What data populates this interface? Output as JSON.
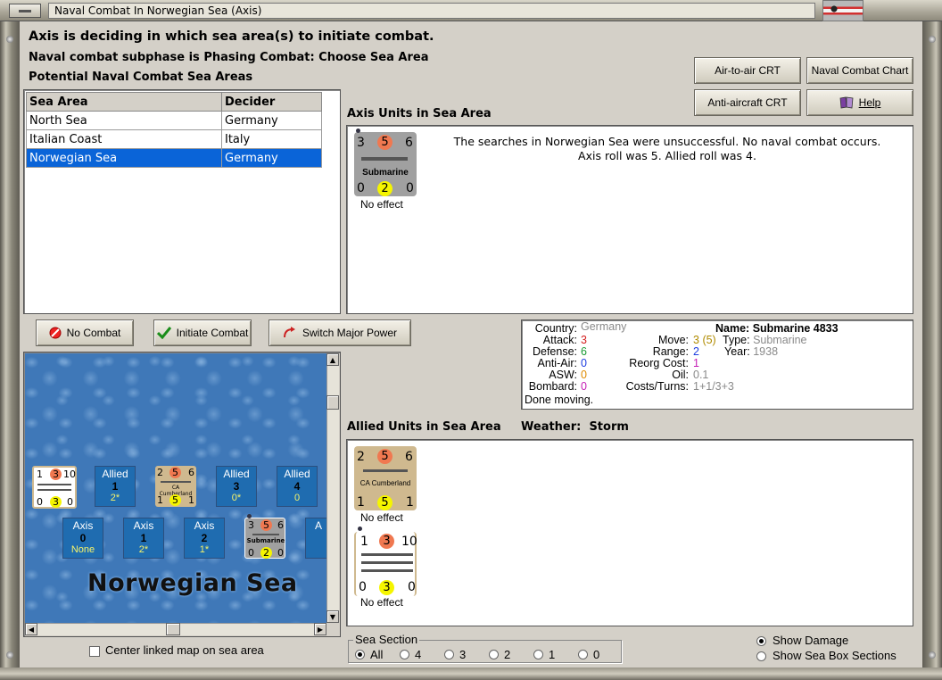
{
  "window": {
    "title": "Naval Combat In Norwegian Sea (Axis)"
  },
  "messages": {
    "headline": "Axis is deciding in which sea area(s) to initiate combat.",
    "subphase": "Naval combat subphase is Phasing Combat: Choose Sea Area",
    "potential_label": "Potential Naval Combat Sea Areas"
  },
  "top_buttons": {
    "air_to_air": "Air-to-air CRT",
    "naval_chart": "Naval Combat Chart",
    "anti_aircraft": "Anti-aircraft CRT",
    "help": "Help"
  },
  "sea_table": {
    "columns": [
      "Sea Area",
      "Decider"
    ],
    "rows": [
      [
        "North Sea",
        "Germany"
      ],
      [
        "Italian Coast",
        "Italy"
      ],
      [
        "Norwegian Sea",
        "Germany"
      ]
    ],
    "selected_row": 2
  },
  "axis_units": {
    "label": "Axis Units in Sea Area",
    "counter": {
      "left": "3",
      "mid": "5",
      "right": "6",
      "type": "Submarine",
      "bl": "0",
      "bm": "2",
      "br": "0"
    },
    "effect": "No effect",
    "result_line1": "The searches in Norwegian Sea were unsuccessful.  No naval combat occurs.",
    "result_line2": "Axis roll was 5.  Allied roll was 4."
  },
  "action_buttons": {
    "no_combat": "No Combat",
    "initiate": "Initiate Combat",
    "switch": "Switch Major Power"
  },
  "unit_info": {
    "country_k": "Country:",
    "country_v": "Germany",
    "attack_k": "Attack:",
    "attack_v": "3",
    "defense_k": "Defense:",
    "defense_v": "6",
    "antiair_k": "Anti-Air:",
    "antiair_v": "0",
    "asw_k": "ASW:",
    "asw_v": "0",
    "bombard_k": "Bombard:",
    "bombard_v": "0",
    "status": "Done moving.",
    "move_k": "Move:",
    "move_v": "3",
    "move_extra": "(5)",
    "range_k": "Range:",
    "range_v": "2",
    "reorg_k": "Reorg Cost:",
    "reorg_v": "1",
    "oil_k": "Oil:",
    "oil_v": "0.1",
    "costs_k": "Costs/Turns:",
    "costs_v": "1+1/3+3",
    "name_k": "Name:",
    "name_v": "Submarine 4833",
    "type_k": "Type:",
    "type_v": "Submarine",
    "year_k": "Year:",
    "year_v": "1938"
  },
  "allied": {
    "label": "Allied Units in Sea Area",
    "weather_label": "Weather:",
    "weather_value": "Storm",
    "counter1": {
      "left": "2",
      "mid": "5",
      "right": "6",
      "type": "CA Cumberland",
      "bl": "1",
      "bm": "5",
      "br": "1",
      "effect": "No effect"
    },
    "counter2": {
      "left": "1",
      "mid": "3",
      "right": "10",
      "bl": "0",
      "bm": "3",
      "br": "0",
      "effect": "No effect"
    }
  },
  "map": {
    "sea_name": "Norwegian Sea",
    "allied_boxes": [
      {
        "label": "Allied",
        "num": "1",
        "sub": "2*"
      },
      {
        "label": "Allied",
        "num": "3",
        "sub": "0*"
      },
      {
        "label": "Allied",
        "num": "4",
        "sub": "0"
      }
    ],
    "axis_boxes": [
      {
        "label": "Axis",
        "num": "0",
        "sub": "None"
      },
      {
        "label": "Axis",
        "num": "1",
        "sub": "2*"
      },
      {
        "label": "Axis",
        "num": "2",
        "sub": "1*"
      },
      {
        "label": "A",
        "num": "",
        "sub": ""
      }
    ],
    "mini_allied_a": {
      "l": "1",
      "m": "3",
      "r": "10",
      "bl": "0",
      "bm": "3",
      "br": "0"
    },
    "mini_allied_b": {
      "l": "2",
      "m": "5",
      "r": "6",
      "type": "CA Cumberland",
      "bl": "1",
      "bm": "5",
      "br": "1"
    },
    "mini_axis": {
      "l": "3",
      "m": "5",
      "r": "6",
      "type": "Submarine",
      "bl": "0",
      "bm": "2",
      "br": "0"
    }
  },
  "bottom": {
    "center_map": "Center linked map on sea area",
    "sea_section": "Sea Section",
    "options": [
      "All",
      "4",
      "3",
      "2",
      "1",
      "0"
    ],
    "show_damage": "Show Damage",
    "show_boxes": "Show Sea Box Sections"
  },
  "colors": {
    "selection": "#0a64d8",
    "axis_counter": "#a0a0a0",
    "allied_counter": "#cfb98f",
    "map_sea": "#3f78b8"
  }
}
